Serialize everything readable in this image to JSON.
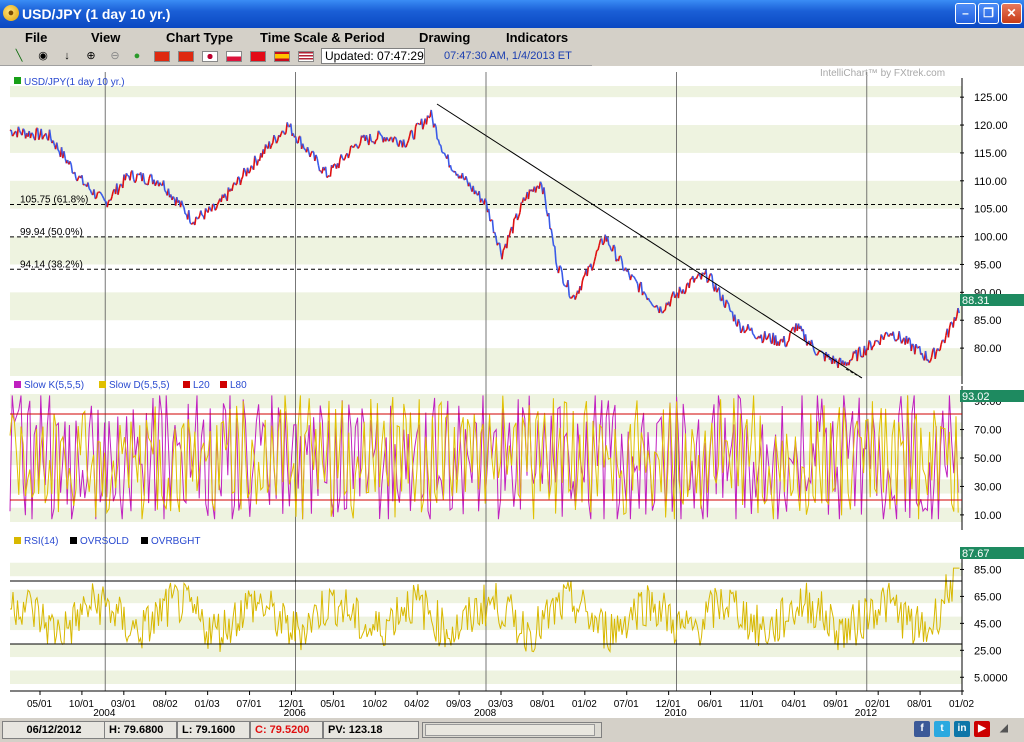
{
  "window": {
    "title": "USD/JPY (1 day  10 yr.)"
  },
  "menu": [
    "File",
    "View",
    "Chart Type",
    "Time Scale & Period",
    "Drawing",
    "Indicators"
  ],
  "toolbar": {
    "updated_label": "Updated: 07:47:29",
    "updated_time": "07:47:30 AM, 1/4/2013 ET",
    "tools": [
      "line-tool-icon",
      "target-icon",
      "arrow-down-icon",
      "zoom-in-icon",
      "zoom-out-icon",
      "color-icon"
    ],
    "flags": [
      "china-flag",
      "hongkong-flag",
      "japan-flag",
      "poland-flag",
      "turkey-flag",
      "spain-flag",
      "usa-flag"
    ]
  },
  "watermark": "IntelliChart™ by FXtrek.com",
  "colors": {
    "price_up": "#e01010",
    "price_down": "#3a5ae8",
    "slow_k": "#c020c0",
    "slow_d": "#e0c000",
    "rsi": "#d8b800",
    "level_line": "#d00000",
    "grid_band": "#eef3e0",
    "value_tag": "#1e8a60"
  },
  "chart_data": [
    {
      "type": "line",
      "title": "USD/JPY(1 day  10 yr.)",
      "series": [
        {
          "name": "USD/JPY(1 day  10 yr.)",
          "x_range": [
            "2003-01",
            "2013-01"
          ]
        }
      ],
      "ylim": [
        75,
        127
      ],
      "yticks": [
        "125.00",
        "120.00",
        "115.00",
        "110.00",
        "105.00",
        "100.00",
        "95.00",
        "90.00",
        "85.00",
        "80.00"
      ],
      "last_value": "88.31",
      "fib_levels": [
        {
          "label": "105.75 (61.8%)",
          "value": 105.75
        },
        {
          "label": "99.94 (50.0%)",
          "value": 99.94
        },
        {
          "label": "94.14 (38.2%)",
          "value": 94.14
        }
      ],
      "keypoints": [
        [
          "2003-01",
          119
        ],
        [
          "2003-06",
          118
        ],
        [
          "2003-10",
          110
        ],
        [
          "2004-01",
          106
        ],
        [
          "2004-04",
          111
        ],
        [
          "2004-08",
          110
        ],
        [
          "2004-12",
          103
        ],
        [
          "2005-03",
          105
        ],
        [
          "2005-07",
          112
        ],
        [
          "2005-12",
          120
        ],
        [
          "2006-05",
          111
        ],
        [
          "2006-09",
          117
        ],
        [
          "2006-12",
          118
        ],
        [
          "2007-03",
          117
        ],
        [
          "2007-06",
          122
        ],
        [
          "2007-08",
          114
        ],
        [
          "2007-11",
          109
        ],
        [
          "2008-01",
          106
        ],
        [
          "2008-03",
          97
        ],
        [
          "2008-06",
          107
        ],
        [
          "2008-08",
          110
        ],
        [
          "2008-10",
          95
        ],
        [
          "2008-12",
          89
        ],
        [
          "2009-02",
          94
        ],
        [
          "2009-04",
          100
        ],
        [
          "2009-07",
          93
        ],
        [
          "2009-11",
          87
        ],
        [
          "2010-03",
          92
        ],
        [
          "2010-05",
          93
        ],
        [
          "2010-09",
          84
        ],
        [
          "2010-12",
          82
        ],
        [
          "2011-03",
          81
        ],
        [
          "2011-04",
          84
        ],
        [
          "2011-07",
          79
        ],
        [
          "2011-10",
          77
        ],
        [
          "2012-02",
          81
        ],
        [
          "2012-04",
          83
        ],
        [
          "2012-09",
          78
        ],
        [
          "2012-11",
          82
        ],
        [
          "2013-01",
          88.31
        ]
      ]
    },
    {
      "type": "line",
      "series": [
        {
          "name": "Slow K(5,5,5)"
        },
        {
          "name": "Slow D(5,5,5)"
        },
        {
          "name": "L20",
          "value": 20
        },
        {
          "name": "L80",
          "value": 80
        }
      ],
      "ylim": [
        5,
        95
      ],
      "yticks": [
        "90.00",
        "70.00",
        "50.00",
        "30.00",
        "10.00"
      ],
      "last_value": "93.02"
    },
    {
      "type": "line",
      "series": [
        {
          "name": "RSI(14)"
        },
        {
          "name": "OVRSOLD",
          "value": 30
        },
        {
          "name": "OVRBGHT",
          "value": 70
        }
      ],
      "ylim": [
        0,
        95
      ],
      "yticks": [
        "85.00",
        "65.00",
        "45.00",
        "25.00",
        "5.0000"
      ],
      "last_value": "87.67"
    }
  ],
  "x_axis": {
    "month_labels": [
      "05/01",
      "10/01",
      "03/01",
      "08/02",
      "01/03",
      "07/01",
      "12/01",
      "05/01",
      "10/02",
      "04/02",
      "09/03",
      "03/03",
      "08/01",
      "01/02",
      "07/01",
      "12/01",
      "06/01",
      "11/01",
      "04/01",
      "09/01",
      "02/01",
      "08/01",
      "01/02"
    ],
    "year_labels": [
      "2004",
      "2006",
      "2008",
      "2010",
      "2012"
    ]
  },
  "statusbar": {
    "date": "06/12/2012",
    "high": "H: 79.6800",
    "low": "L: 79.1600",
    "close": "C: 79.5200",
    "pv": "PV: 123.18"
  }
}
